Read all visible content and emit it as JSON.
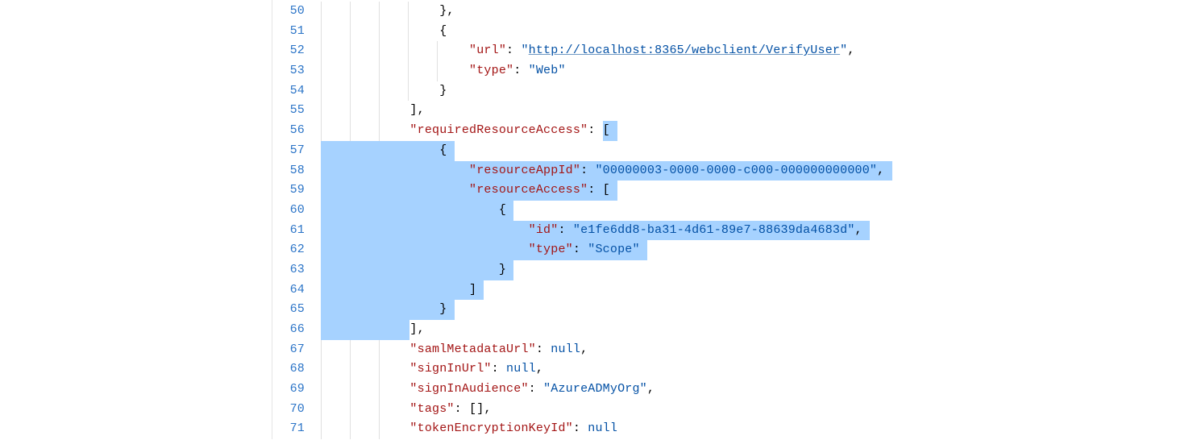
{
  "code": {
    "lines": [
      {
        "num": "50",
        "indent": 4,
        "selected": false,
        "tokens": [
          {
            "cls": "tok-punc",
            "t": "},"
          }
        ]
      },
      {
        "num": "51",
        "indent": 4,
        "selected": false,
        "tokens": [
          {
            "cls": "tok-punc",
            "t": "{"
          }
        ]
      },
      {
        "num": "52",
        "indent": 5,
        "selected": false,
        "tokens": [
          {
            "cls": "tok-key",
            "t": "\"url\""
          },
          {
            "cls": "tok-punc",
            "t": ": "
          },
          {
            "cls": "tok-str",
            "t": "\""
          },
          {
            "cls": "tok-url",
            "t": "http://localhost:8365/webclient/VerifyUser"
          },
          {
            "cls": "tok-str",
            "t": "\""
          },
          {
            "cls": "tok-punc",
            "t": ","
          }
        ]
      },
      {
        "num": "53",
        "indent": 5,
        "selected": false,
        "tokens": [
          {
            "cls": "tok-key",
            "t": "\"type\""
          },
          {
            "cls": "tok-punc",
            "t": ": "
          },
          {
            "cls": "tok-str",
            "t": "\"Web\""
          }
        ]
      },
      {
        "num": "54",
        "indent": 4,
        "selected": false,
        "tokens": [
          {
            "cls": "tok-punc",
            "t": "}"
          }
        ]
      },
      {
        "num": "55",
        "indent": 3,
        "selected": false,
        "tokens": [
          {
            "cls": "tok-punc",
            "t": "],"
          }
        ]
      },
      {
        "num": "56",
        "indent": 3,
        "selected": false,
        "selectTail": true,
        "tokens": [
          {
            "cls": "tok-key",
            "t": "\"requiredResourceAccess\""
          },
          {
            "cls": "tok-punc",
            "t": ": "
          },
          {
            "cls": "tok-punc",
            "t": "[",
            "sel": true
          }
        ]
      },
      {
        "num": "57",
        "indent": 4,
        "selected": true,
        "tokens": [
          {
            "cls": "tok-punc",
            "t": "{"
          }
        ]
      },
      {
        "num": "58",
        "indent": 5,
        "selected": true,
        "tokens": [
          {
            "cls": "tok-key",
            "t": "\"resourceAppId\""
          },
          {
            "cls": "tok-punc",
            "t": ": "
          },
          {
            "cls": "tok-str",
            "t": "\"00000003-0000-0000-c000-000000000000\""
          },
          {
            "cls": "tok-punc",
            "t": ","
          }
        ]
      },
      {
        "num": "59",
        "indent": 5,
        "selected": true,
        "tokens": [
          {
            "cls": "tok-key",
            "t": "\"resourceAccess\""
          },
          {
            "cls": "tok-punc",
            "t": ": ["
          }
        ]
      },
      {
        "num": "60",
        "indent": 6,
        "selected": true,
        "tokens": [
          {
            "cls": "tok-punc",
            "t": "{"
          }
        ]
      },
      {
        "num": "61",
        "indent": 7,
        "selected": true,
        "tokens": [
          {
            "cls": "tok-key",
            "t": "\"id\""
          },
          {
            "cls": "tok-punc",
            "t": ": "
          },
          {
            "cls": "tok-str",
            "t": "\"e1fe6dd8-ba31-4d61-89e7-88639da4683d\""
          },
          {
            "cls": "tok-punc",
            "t": ","
          }
        ]
      },
      {
        "num": "62",
        "indent": 7,
        "selected": true,
        "tokens": [
          {
            "cls": "tok-key",
            "t": "\"type\""
          },
          {
            "cls": "tok-punc",
            "t": ": "
          },
          {
            "cls": "tok-str",
            "t": "\"Scope\""
          }
        ]
      },
      {
        "num": "63",
        "indent": 6,
        "selected": true,
        "tokens": [
          {
            "cls": "tok-punc",
            "t": "}"
          }
        ]
      },
      {
        "num": "64",
        "indent": 5,
        "selected": true,
        "tokens": [
          {
            "cls": "tok-punc",
            "t": "]"
          }
        ]
      },
      {
        "num": "65",
        "indent": 4,
        "selected": true,
        "tokens": [
          {
            "cls": "tok-punc",
            "t": "}"
          }
        ]
      },
      {
        "num": "66",
        "indent": 3,
        "selected": false,
        "selectHead": true,
        "tokens": [
          {
            "cls": "tok-punc",
            "t": "],"
          }
        ]
      },
      {
        "num": "67",
        "indent": 3,
        "selected": false,
        "tokens": [
          {
            "cls": "tok-key",
            "t": "\"samlMetadataUrl\""
          },
          {
            "cls": "tok-punc",
            "t": ": "
          },
          {
            "cls": "tok-null",
            "t": "null"
          },
          {
            "cls": "tok-punc",
            "t": ","
          }
        ]
      },
      {
        "num": "68",
        "indent": 3,
        "selected": false,
        "tokens": [
          {
            "cls": "tok-key",
            "t": "\"signInUrl\""
          },
          {
            "cls": "tok-punc",
            "t": ": "
          },
          {
            "cls": "tok-null",
            "t": "null"
          },
          {
            "cls": "tok-punc",
            "t": ","
          }
        ]
      },
      {
        "num": "69",
        "indent": 3,
        "selected": false,
        "tokens": [
          {
            "cls": "tok-key",
            "t": "\"signInAudience\""
          },
          {
            "cls": "tok-punc",
            "t": ": "
          },
          {
            "cls": "tok-str",
            "t": "\"AzureADMyOrg\""
          },
          {
            "cls": "tok-punc",
            "t": ","
          }
        ]
      },
      {
        "num": "70",
        "indent": 3,
        "selected": false,
        "tokens": [
          {
            "cls": "tok-key",
            "t": "\"tags\""
          },
          {
            "cls": "tok-punc",
            "t": ": [],"
          }
        ]
      },
      {
        "num": "71",
        "indent": 3,
        "selected": false,
        "tokens": [
          {
            "cls": "tok-key",
            "t": "\"tokenEncryptionKeyId\""
          },
          {
            "cls": "tok-punc",
            "t": ": "
          },
          {
            "cls": "tok-null",
            "t": "null"
          }
        ]
      }
    ]
  },
  "labels": {
    "gutter": "line-number",
    "code": "code-line"
  }
}
